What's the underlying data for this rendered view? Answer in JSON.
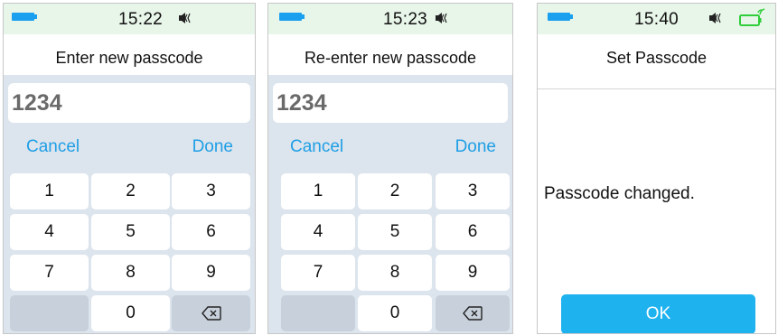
{
  "screens": [
    {
      "status": {
        "time": "15:22",
        "battery_icon": "battery-icon",
        "speaker_icon": "speaker-mute-icon"
      },
      "title": "Enter new passcode",
      "entry_value": "1234",
      "cancel_label": "Cancel",
      "done_label": "Done",
      "keys": [
        "1",
        "2",
        "3",
        "4",
        "5",
        "6",
        "7",
        "8",
        "9",
        "0"
      ],
      "delete_icon": "backspace-icon"
    },
    {
      "status": {
        "time": "15:23",
        "battery_icon": "battery-icon",
        "speaker_icon": "speaker-mute-icon"
      },
      "title": "Re-enter new passcode",
      "entry_value": "1234",
      "cancel_label": "Cancel",
      "done_label": "Done",
      "keys": [
        "1",
        "2",
        "3",
        "4",
        "5",
        "6",
        "7",
        "8",
        "9",
        "0"
      ],
      "delete_icon": "backspace-icon"
    },
    {
      "status": {
        "time": "15:40",
        "battery_icon": "battery-icon",
        "speaker_icon": "speaker-mute-icon",
        "charge_icon": "charging-battery-icon"
      },
      "title": "Set Passcode",
      "message": "Passcode changed.",
      "ok_label": "OK"
    }
  ],
  "colors": {
    "accent": "#1f9fe6",
    "status_bar": "#e8f5e9",
    "keypad_bg": "#dce4ed",
    "ok_button": "#1eb2ef",
    "charging_green": "#2fce3a"
  }
}
